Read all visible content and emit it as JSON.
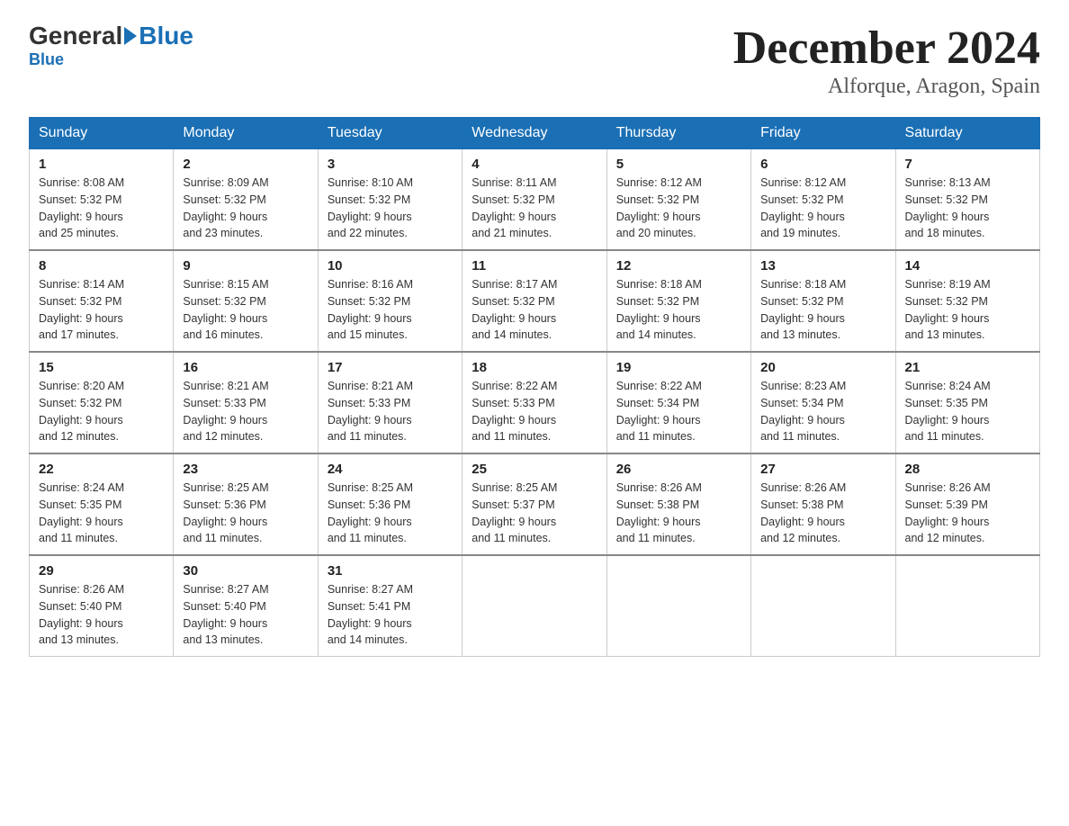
{
  "header": {
    "logo_general": "General",
    "logo_blue": "Blue",
    "month_title": "December 2024",
    "location": "Alforque, Aragon, Spain"
  },
  "days_of_week": [
    "Sunday",
    "Monday",
    "Tuesday",
    "Wednesday",
    "Thursday",
    "Friday",
    "Saturday"
  ],
  "weeks": [
    [
      {
        "day": "1",
        "sunrise": "8:08 AM",
        "sunset": "5:32 PM",
        "daylight": "9 hours and 25 minutes."
      },
      {
        "day": "2",
        "sunrise": "8:09 AM",
        "sunset": "5:32 PM",
        "daylight": "9 hours and 23 minutes."
      },
      {
        "day": "3",
        "sunrise": "8:10 AM",
        "sunset": "5:32 PM",
        "daylight": "9 hours and 22 minutes."
      },
      {
        "day": "4",
        "sunrise": "8:11 AM",
        "sunset": "5:32 PM",
        "daylight": "9 hours and 21 minutes."
      },
      {
        "day": "5",
        "sunrise": "8:12 AM",
        "sunset": "5:32 PM",
        "daylight": "9 hours and 20 minutes."
      },
      {
        "day": "6",
        "sunrise": "8:12 AM",
        "sunset": "5:32 PM",
        "daylight": "9 hours and 19 minutes."
      },
      {
        "day": "7",
        "sunrise": "8:13 AM",
        "sunset": "5:32 PM",
        "daylight": "9 hours and 18 minutes."
      }
    ],
    [
      {
        "day": "8",
        "sunrise": "8:14 AM",
        "sunset": "5:32 PM",
        "daylight": "9 hours and 17 minutes."
      },
      {
        "day": "9",
        "sunrise": "8:15 AM",
        "sunset": "5:32 PM",
        "daylight": "9 hours and 16 minutes."
      },
      {
        "day": "10",
        "sunrise": "8:16 AM",
        "sunset": "5:32 PM",
        "daylight": "9 hours and 15 minutes."
      },
      {
        "day": "11",
        "sunrise": "8:17 AM",
        "sunset": "5:32 PM",
        "daylight": "9 hours and 14 minutes."
      },
      {
        "day": "12",
        "sunrise": "8:18 AM",
        "sunset": "5:32 PM",
        "daylight": "9 hours and 14 minutes."
      },
      {
        "day": "13",
        "sunrise": "8:18 AM",
        "sunset": "5:32 PM",
        "daylight": "9 hours and 13 minutes."
      },
      {
        "day": "14",
        "sunrise": "8:19 AM",
        "sunset": "5:32 PM",
        "daylight": "9 hours and 13 minutes."
      }
    ],
    [
      {
        "day": "15",
        "sunrise": "8:20 AM",
        "sunset": "5:32 PM",
        "daylight": "9 hours and 12 minutes."
      },
      {
        "day": "16",
        "sunrise": "8:21 AM",
        "sunset": "5:33 PM",
        "daylight": "9 hours and 12 minutes."
      },
      {
        "day": "17",
        "sunrise": "8:21 AM",
        "sunset": "5:33 PM",
        "daylight": "9 hours and 11 minutes."
      },
      {
        "day": "18",
        "sunrise": "8:22 AM",
        "sunset": "5:33 PM",
        "daylight": "9 hours and 11 minutes."
      },
      {
        "day": "19",
        "sunrise": "8:22 AM",
        "sunset": "5:34 PM",
        "daylight": "9 hours and 11 minutes."
      },
      {
        "day": "20",
        "sunrise": "8:23 AM",
        "sunset": "5:34 PM",
        "daylight": "9 hours and 11 minutes."
      },
      {
        "day": "21",
        "sunrise": "8:24 AM",
        "sunset": "5:35 PM",
        "daylight": "9 hours and 11 minutes."
      }
    ],
    [
      {
        "day": "22",
        "sunrise": "8:24 AM",
        "sunset": "5:35 PM",
        "daylight": "9 hours and 11 minutes."
      },
      {
        "day": "23",
        "sunrise": "8:25 AM",
        "sunset": "5:36 PM",
        "daylight": "9 hours and 11 minutes."
      },
      {
        "day": "24",
        "sunrise": "8:25 AM",
        "sunset": "5:36 PM",
        "daylight": "9 hours and 11 minutes."
      },
      {
        "day": "25",
        "sunrise": "8:25 AM",
        "sunset": "5:37 PM",
        "daylight": "9 hours and 11 minutes."
      },
      {
        "day": "26",
        "sunrise": "8:26 AM",
        "sunset": "5:38 PM",
        "daylight": "9 hours and 11 minutes."
      },
      {
        "day": "27",
        "sunrise": "8:26 AM",
        "sunset": "5:38 PM",
        "daylight": "9 hours and 12 minutes."
      },
      {
        "day": "28",
        "sunrise": "8:26 AM",
        "sunset": "5:39 PM",
        "daylight": "9 hours and 12 minutes."
      }
    ],
    [
      {
        "day": "29",
        "sunrise": "8:26 AM",
        "sunset": "5:40 PM",
        "daylight": "9 hours and 13 minutes."
      },
      {
        "day": "30",
        "sunrise": "8:27 AM",
        "sunset": "5:40 PM",
        "daylight": "9 hours and 13 minutes."
      },
      {
        "day": "31",
        "sunrise": "8:27 AM",
        "sunset": "5:41 PM",
        "daylight": "9 hours and 14 minutes."
      },
      null,
      null,
      null,
      null
    ]
  ],
  "labels": {
    "sunrise": "Sunrise:",
    "sunset": "Sunset:",
    "daylight": "Daylight:"
  }
}
